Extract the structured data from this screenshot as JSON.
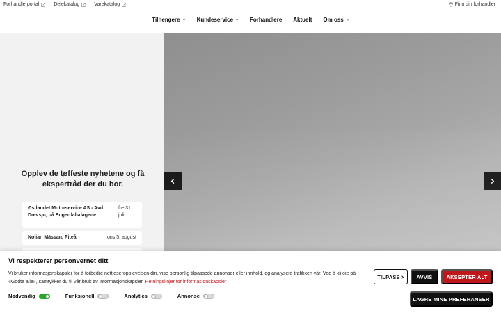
{
  "util": {
    "links": [
      "Forhandlerportal",
      "Delekatalog",
      "Varekatalog"
    ],
    "find_dealer": "Finn din forhandler"
  },
  "nav": {
    "items": [
      {
        "label": "Tilhengere",
        "dropdown": true
      },
      {
        "label": "Kundeservice",
        "dropdown": true
      },
      {
        "label": "Forhandlere",
        "dropdown": false
      },
      {
        "label": "Aktuelt",
        "dropdown": false
      },
      {
        "label": "Om oss",
        "dropdown": true
      }
    ]
  },
  "promo": {
    "title": "Opplev de tøffeste nyhetene og få ekspertråd der du bor.",
    "events": [
      {
        "name": "Østlandet Motorservice AS - Avd. Drevsjø, på Engerdalsdagene",
        "date": "fre 31. juli"
      },
      {
        "name": "Nolian Mässan, Piteå",
        "date": "ons 5. august"
      },
      {
        "name": "",
        "date": ""
      }
    ]
  },
  "cookie": {
    "title": "Vi respekterer personvernet ditt",
    "text": "Vi bruker informasjonskapsler for å forbedre nettleseropplevelsen din, vise personlig tilpassede annonser eller innhold, og analysere trafikken vår. Ved å klikke på «Godta alle», samtykker du til vår bruk av informasjonskapsler.",
    "link": "Retningslinjer for informasjonskapsler",
    "toggles": [
      {
        "label": "Nødvendig",
        "on": true
      },
      {
        "label": "Funksjonell",
        "on": false
      },
      {
        "label": "Analytics",
        "on": false
      },
      {
        "label": "Annonse",
        "on": false
      }
    ],
    "buttons": {
      "customize": "TILPASS",
      "reject": "AVVIS",
      "accept": "AKSEPTER ALT",
      "save": "LAGRE MINE PREFERANSER"
    }
  },
  "colors": {
    "accent": "#c0171c",
    "toggle_on": "#2aa52e",
    "dark": "#111111"
  }
}
